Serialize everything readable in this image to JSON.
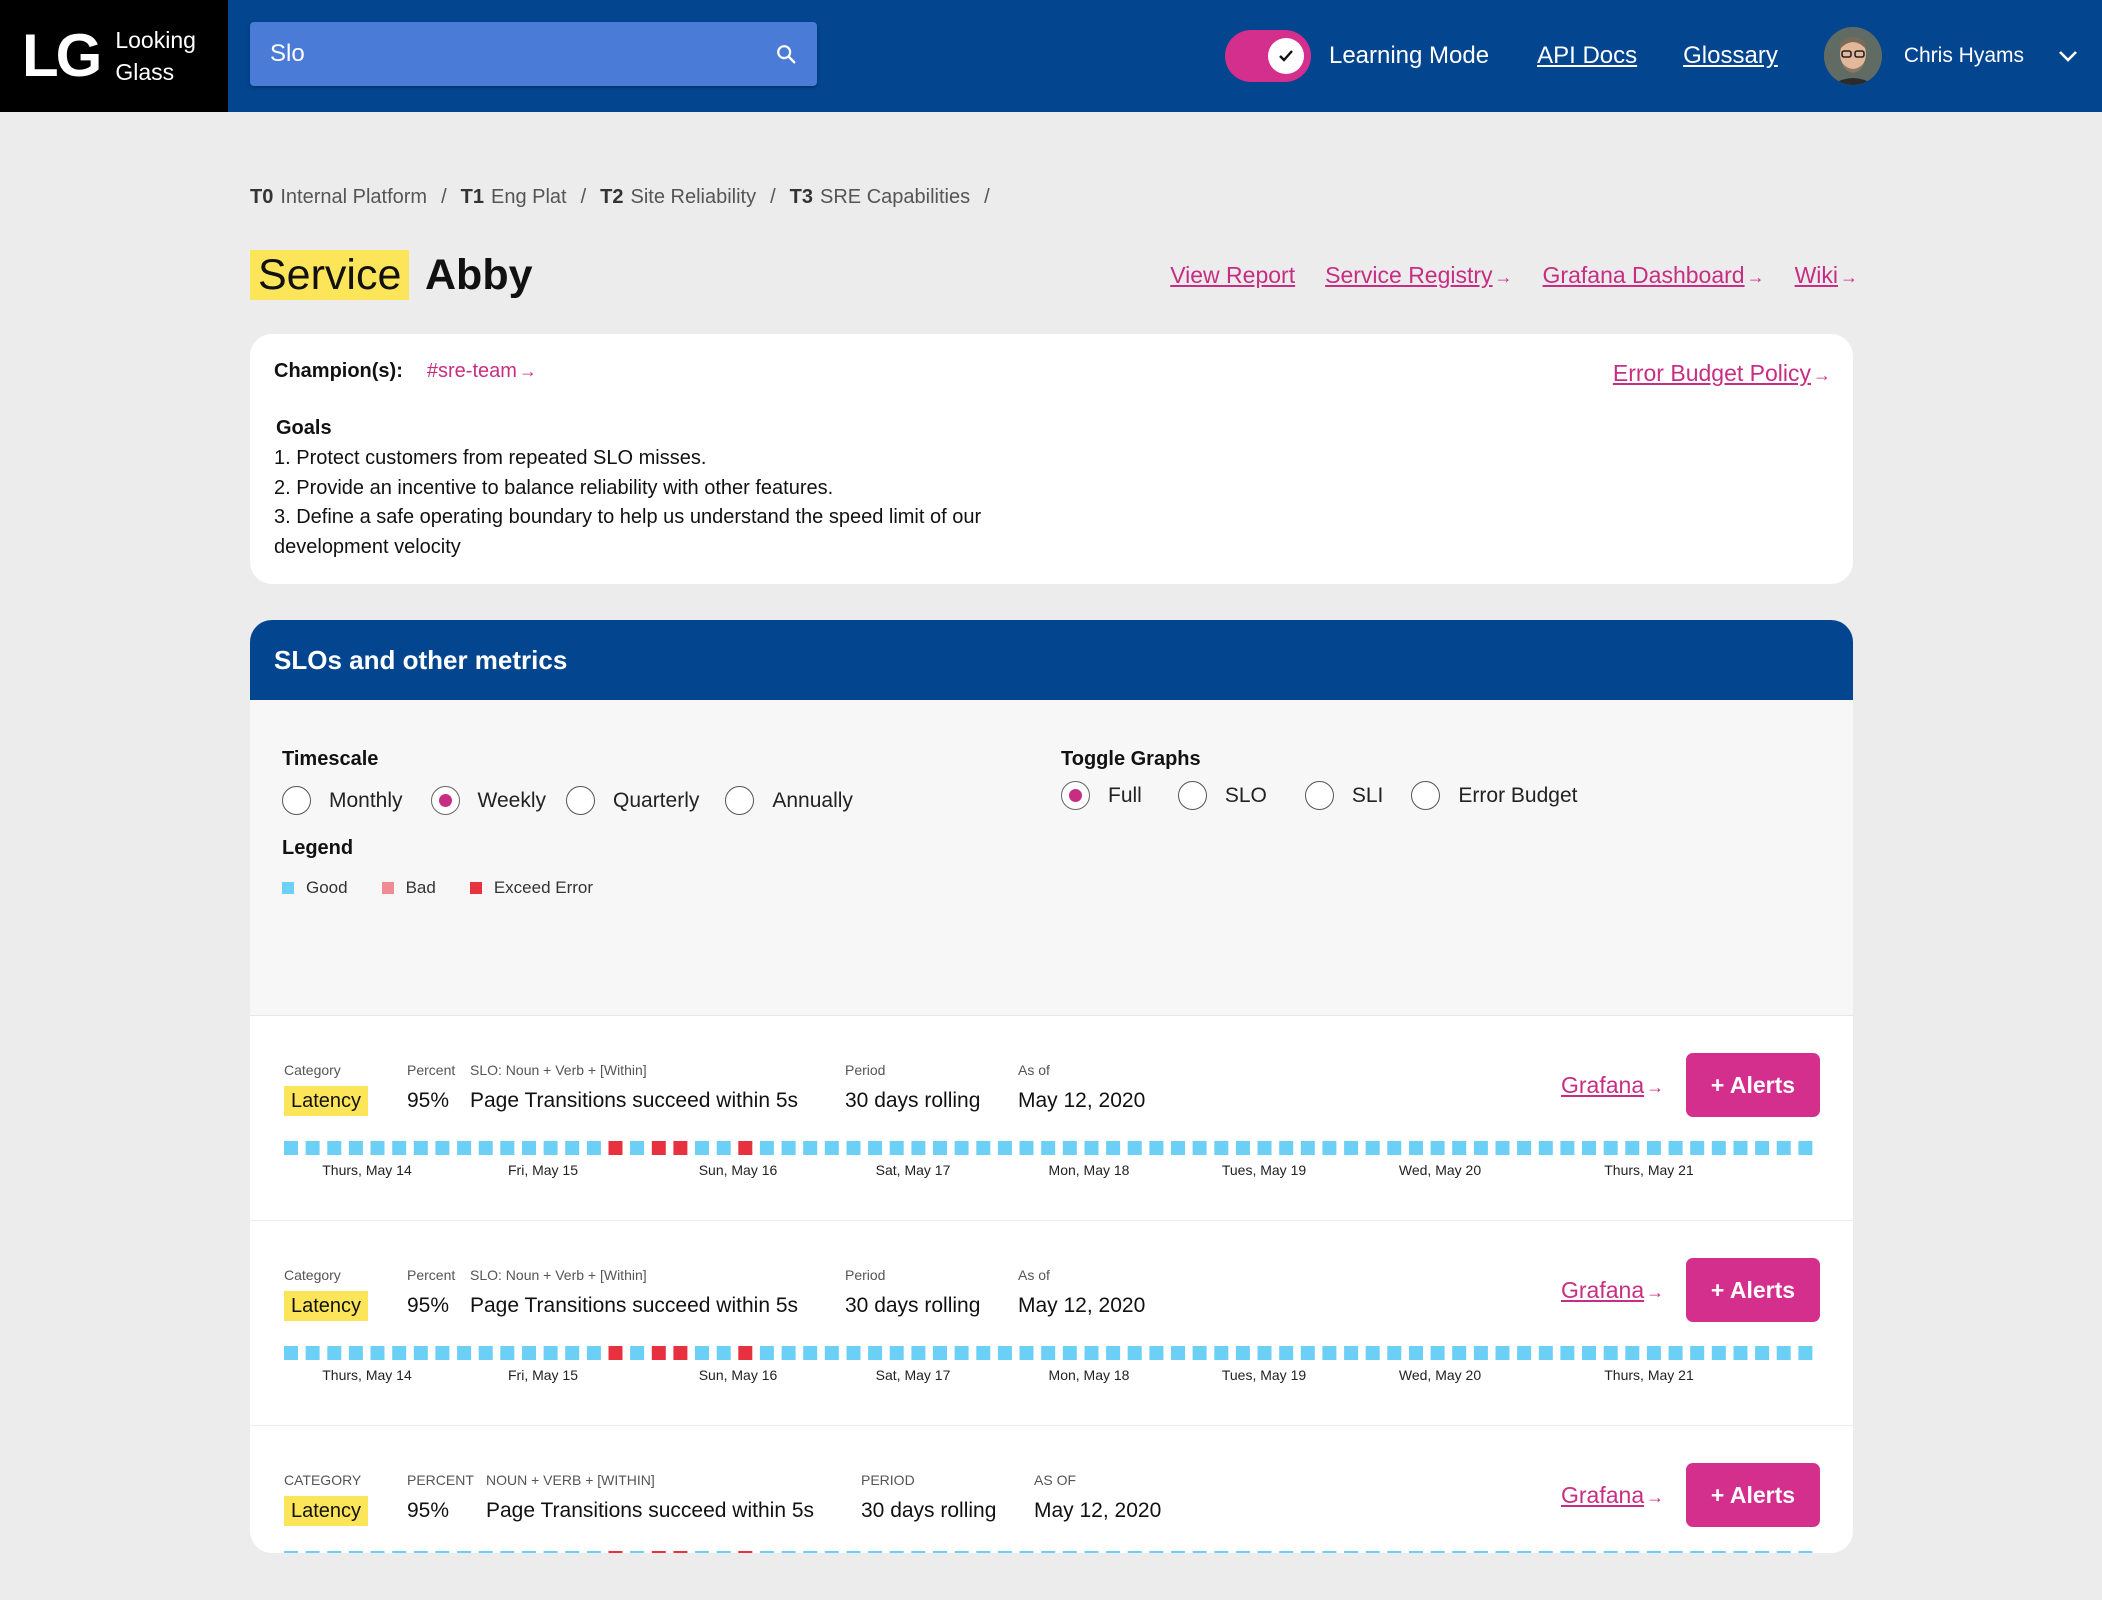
{
  "app": {
    "logo_mark": "LG",
    "logo_line1": "Looking",
    "logo_line2": "Glass"
  },
  "search": {
    "value": "Slo"
  },
  "nav": {
    "learning_mode_label": "Learning Mode",
    "learning_mode_on": true,
    "api_docs": "API Docs",
    "glossary": "Glossary",
    "user_name": "Chris Hyams"
  },
  "breadcrumb": [
    {
      "tier": "T0",
      "name": "Internal Platform"
    },
    {
      "tier": "T1",
      "name": "Eng Plat"
    },
    {
      "tier": "T2",
      "name": "Site Reliability"
    },
    {
      "tier": "T3",
      "name": "SRE Capabilities"
    }
  ],
  "page": {
    "type_label": "Service",
    "service_name": "Abby",
    "links": {
      "view_report": "View Report",
      "service_registry": "Service Registry",
      "grafana_dashboard": "Grafana Dashboard",
      "wiki": "Wiki"
    }
  },
  "info": {
    "champions_label": "Champion(s):",
    "champion_channel": "#sre-team",
    "error_budget_policy": "Error Budget Policy",
    "goals_title": "Goals",
    "goals": [
      "1. Protect customers from repeated SLO misses.",
      "2. Provide an incentive to balance reliability with other features.",
      "3. Define a safe operating boundary to help us understand the speed limit of our development velocity"
    ]
  },
  "slo_panel": {
    "title": "SLOs and other metrics",
    "timescale": {
      "title": "Timescale",
      "options": [
        "Monthly",
        "Weekly",
        "Quarterly",
        "Annually"
      ],
      "selected": "Weekly"
    },
    "toggle_graphs": {
      "title": "Toggle Graphs",
      "options": [
        "Full",
        "SLO",
        "SLI",
        "Error Budget"
      ],
      "selected": "Full"
    },
    "legend": {
      "title": "Legend",
      "items": [
        {
          "label": "Good",
          "color": "#6ccff6"
        },
        {
          "label": "Bad",
          "color": "#f08a93"
        },
        {
          "label": "Exceed Error",
          "color": "#e8313f"
        }
      ]
    },
    "rows": [
      {
        "labels": {
          "category": "Category",
          "percent": "Percent",
          "slo": "SLO: Noun + Verb + [Within]",
          "period": "Period",
          "as_of": "As of"
        },
        "category": "Latency",
        "percent": "95%",
        "slo": "Page Transitions succeed within 5s",
        "period": "30 days rolling",
        "as_of": "May 12, 2020",
        "grafana": "Grafana",
        "alerts": "+ Alerts"
      },
      {
        "labels": {
          "category": "Category",
          "percent": "Percent",
          "slo": "SLO: Noun + Verb + [Within]",
          "period": "Period",
          "as_of": "As of"
        },
        "category": "Latency",
        "percent": "95%",
        "slo": "Page Transitions succeed within 5s",
        "period": "30 days rolling",
        "as_of": "May 12, 2020",
        "grafana": "Grafana",
        "alerts": "+ Alerts"
      },
      {
        "labels": {
          "category": "CATEGORY",
          "percent": "PERCENT",
          "slo": "NOUN + VERB + [WITHIN]",
          "period": "PERIOD",
          "as_of": "AS OF"
        },
        "category": "Latency",
        "percent": "95%",
        "slo": "Page Transitions succeed within 5s",
        "period": "30 days rolling",
        "as_of": "May 12, 2020",
        "grafana": "Grafana",
        "alerts": "+ Alerts"
      }
    ],
    "timeline": {
      "days": [
        "Thurs, May 14",
        "Fri, May 15",
        "Sun, May 16",
        "Sat, May 17",
        "Mon, May 18",
        "Tues, May 19",
        "Wed, May 20",
        "Thurs, May 21"
      ],
      "segments": [
        "good",
        "good",
        "good",
        "good",
        "good",
        "good",
        "good",
        "good",
        "good",
        "good",
        "good",
        "good",
        "good",
        "good",
        "good",
        "exceed",
        "good",
        "exceed",
        "exceed",
        "good",
        "good",
        "exceed",
        "good",
        "good",
        "good",
        "good",
        "good",
        "good",
        "good",
        "good",
        "good",
        "good",
        "good",
        "good",
        "good",
        "good",
        "good",
        "good",
        "good",
        "good",
        "good",
        "good",
        "good",
        "good",
        "good",
        "good",
        "good",
        "good",
        "good",
        "good",
        "good",
        "good",
        "good",
        "good",
        "good",
        "good",
        "good",
        "good",
        "good",
        "good",
        "good",
        "good",
        "good",
        "good",
        "good",
        "good",
        "good",
        "good",
        "good",
        "good",
        "good"
      ]
    }
  }
}
